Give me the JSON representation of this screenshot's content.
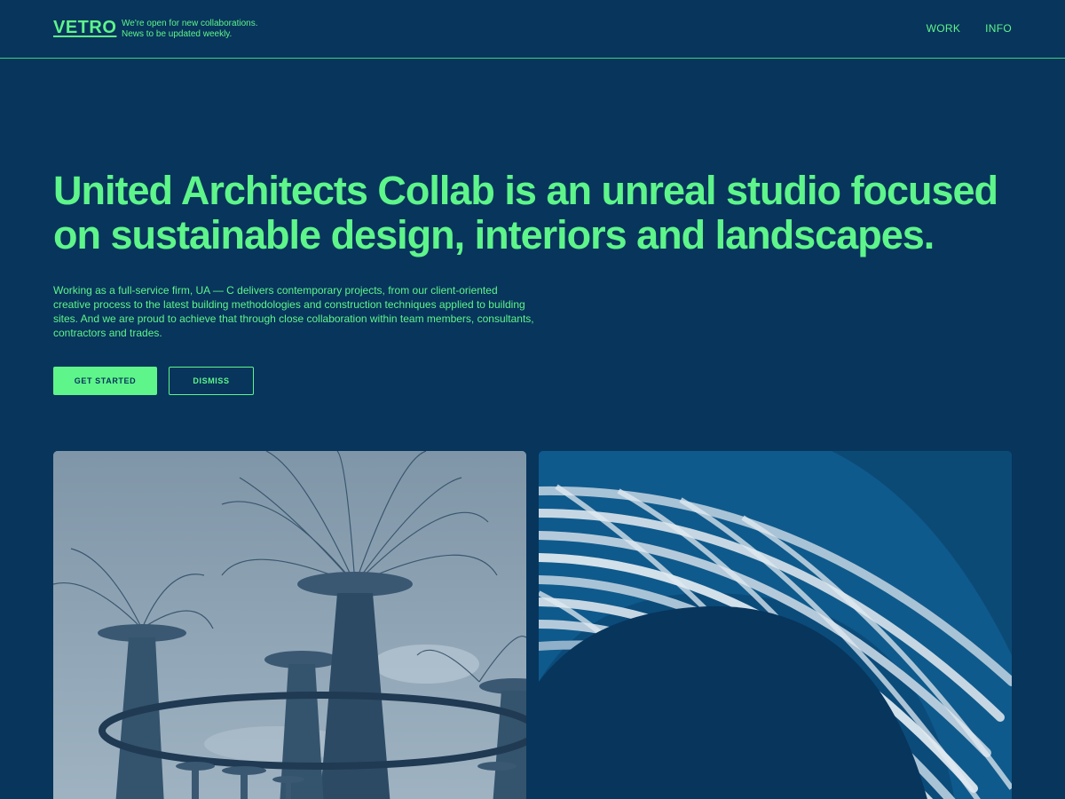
{
  "header": {
    "logo": "VETRO",
    "tagline_line1": "We're open for new collaborations.",
    "tagline_line2": "News to be updated weekly.",
    "nav": [
      {
        "label": "WORK"
      },
      {
        "label": "INFO"
      }
    ]
  },
  "hero": {
    "headline": "United Architects Collab is an unreal studio focused on sustainable design, interiors and landscapes.",
    "lead": "Working as a full-service firm, UA — C delivers contemporary projects, from our client-oriented creative process to the latest building methodologies and construction techniques applied to building sites. And we are proud to achieve that through close collaboration within team members, consultants, contractors and trades.",
    "primary_button": "GET STARTED",
    "secondary_button": "DISMISS"
  },
  "gallery": [
    {
      "subject": "supertree-grove-photo"
    },
    {
      "subject": "woven-arch-structure-photo"
    }
  ],
  "colors": {
    "background": "#08355c",
    "accent": "#5ef58a"
  }
}
